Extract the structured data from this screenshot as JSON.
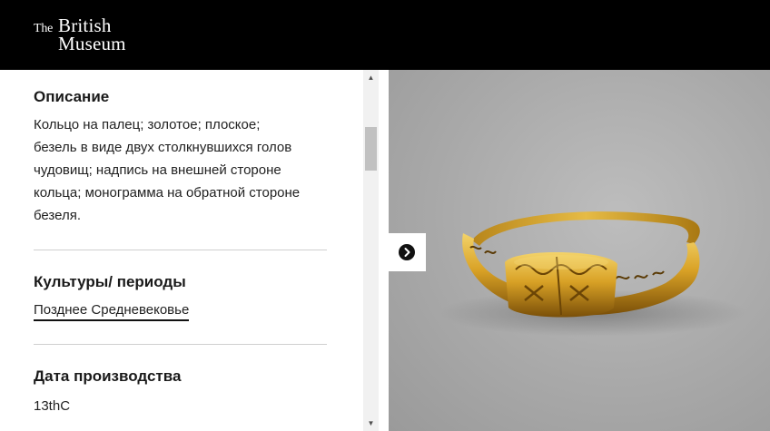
{
  "logo": {
    "the": "The",
    "british": "British",
    "museum": "Museum"
  },
  "description": {
    "title": "Описание",
    "lines": [
      "Кольцо на палец; золотое; плоское;",
      "безель в виде двух столкнувшихся голов",
      "чудовищ; надпись на внешней стороне",
      "кольца; монограмма на обратной стороне",
      "безеля."
    ]
  },
  "cultures": {
    "title": "Культуры/ периоды",
    "link": "Позднее Средневековье"
  },
  "production_date": {
    "title": "Дата производства",
    "value": "13thC"
  },
  "icons": {
    "scroll_up": "scroll-up-arrow",
    "scroll_down": "scroll-down-arrow",
    "next": "chevron-right-circle"
  },
  "colors": {
    "header_bg": "#000000",
    "gold": "#c9961d",
    "photo_bg": "#a8a8a8"
  }
}
